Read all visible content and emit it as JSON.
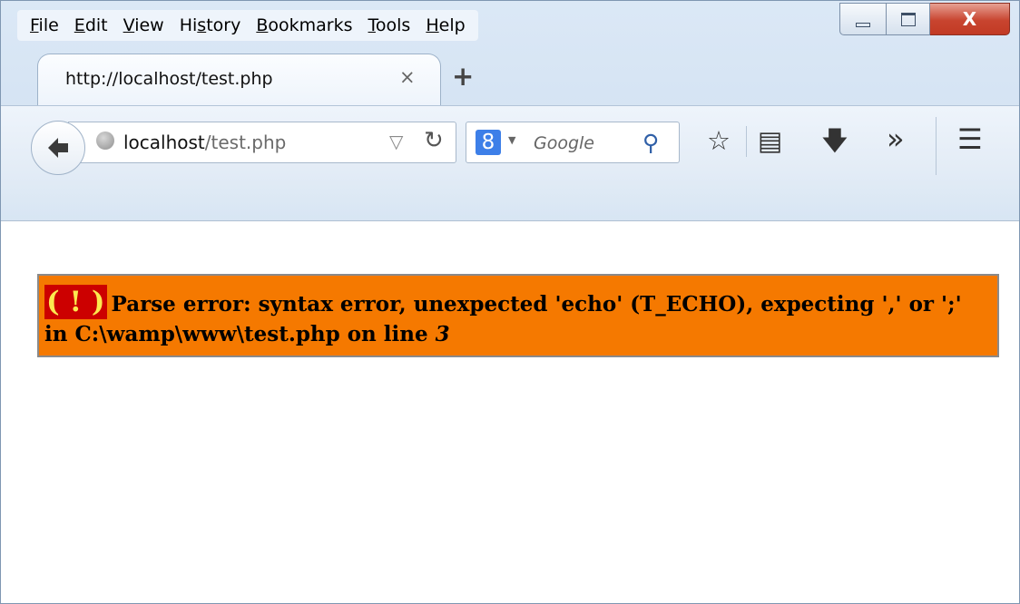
{
  "menu": {
    "items": [
      {
        "key": "F",
        "rest": "ile"
      },
      {
        "key": "E",
        "rest": "dit"
      },
      {
        "key": "V",
        "rest": "iew"
      },
      {
        "pre": "Hi",
        "key": "s",
        "rest": "tory"
      },
      {
        "key": "B",
        "rest": "ookmarks"
      },
      {
        "key": "T",
        "rest": "ools"
      },
      {
        "key": "H",
        "rest": "elp"
      }
    ]
  },
  "tab": {
    "title": "http://localhost/test.php",
    "close": "×"
  },
  "new_tab": "+",
  "urlbar": {
    "host": "localhost",
    "path": "/test.php",
    "dropdown": "▽",
    "reload": "↻"
  },
  "searchbar": {
    "engine_logo": "8",
    "engine_dropdown": "▼",
    "placeholder": "Google",
    "search_glyph": "⚲"
  },
  "toolbar": {
    "bookmark_star": "☆",
    "reading_list": "▤",
    "download": "🡇",
    "overflow": "»",
    "menu": "☰"
  },
  "caption": {
    "close": "X"
  },
  "error": {
    "icon": "( ! )",
    "message": "Parse error: syntax error, unexpected 'echo' (T_ECHO), expecting ',' or ';' in C:\\wamp\\www\\test.php on line ",
    "line": "3"
  },
  "colors": {
    "error_bg": "#f57900",
    "error_icon_bg": "#cc0000",
    "error_icon_fg": "#fce94f",
    "close_button": "#c8442f"
  }
}
